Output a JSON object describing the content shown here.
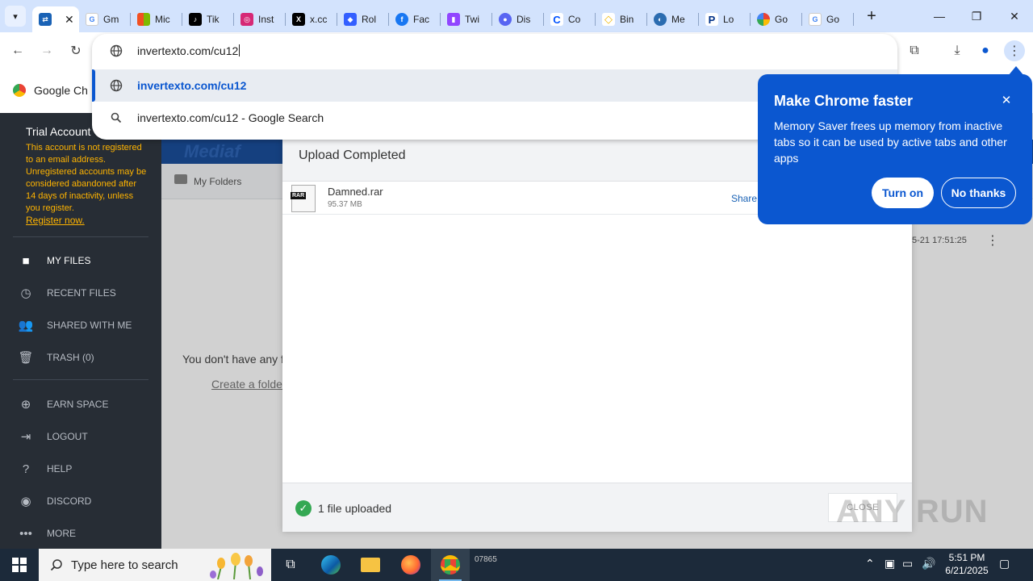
{
  "browser": {
    "tabs": [
      {
        "title": "",
        "active": true
      },
      {
        "title": "Gm"
      },
      {
        "title": "Mic"
      },
      {
        "title": "Tik"
      },
      {
        "title": "Inst"
      },
      {
        "title": "x.cc"
      },
      {
        "title": "Rol"
      },
      {
        "title": "Fac"
      },
      {
        "title": "Twi"
      },
      {
        "title": "Dis"
      },
      {
        "title": "Co"
      },
      {
        "title": "Bin"
      },
      {
        "title": "Me"
      },
      {
        "title": "Lo"
      },
      {
        "title": "Go"
      },
      {
        "title": "Go"
      }
    ],
    "omnibox_text": "invertexto.com/cu12",
    "suggestions": [
      {
        "label": "invertexto.com/cu12"
      },
      {
        "label": "invertexto.com/cu12 - Google Search"
      }
    ],
    "bookmark_label": "Google Ch"
  },
  "promo": {
    "title": "Make Chrome faster",
    "body": "Memory Saver frees up memory from inactive tabs so it can be used by active tabs and other apps",
    "turn_on": "Turn on",
    "no_thanks": "No thanks"
  },
  "sidebar": {
    "trial_title": "Trial Account",
    "trial_message": "This account is not registered to an email address. Unregistered accounts may be considered abandoned after 14 days of inactivity, unless you register.",
    "register_link": "Register now.",
    "items": [
      {
        "label": "MY FILES"
      },
      {
        "label": "RECENT FILES"
      },
      {
        "label": "SHARED WITH ME"
      },
      {
        "label": "TRASH (0)"
      },
      {
        "label": "EARN SPACE"
      },
      {
        "label": "LOGOUT"
      },
      {
        "label": "HELP"
      },
      {
        "label": "DISCORD"
      },
      {
        "label": "MORE"
      }
    ]
  },
  "main": {
    "logo_text": "Mediaf",
    "folders_label": "My Folders",
    "empty_text": "You don't have any f",
    "create_link": "Create a folde",
    "row_date": "5-21 17:51:25"
  },
  "dialog": {
    "title": "Upload Completed",
    "file": {
      "name": "Damned.rar",
      "size": "95.37 MB",
      "share": "Share",
      "badge": "RAR"
    },
    "footer_text": "1 file uploaded",
    "close_label": "CLOSE"
  },
  "watermark": "ANY RUN",
  "taskbar": {
    "search_placeholder": "Type here to search",
    "time": "5:51 PM",
    "date": "6/21/2025",
    "mini_label": "07865"
  }
}
